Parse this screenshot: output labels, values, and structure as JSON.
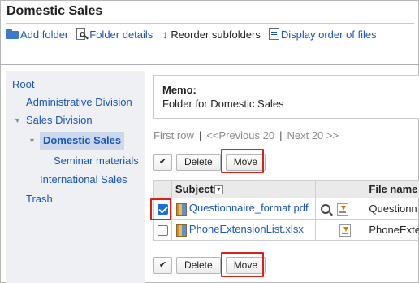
{
  "page": {
    "title": "Domestic Sales"
  },
  "toolbar": {
    "add_folder": "Add folder",
    "folder_details": "Folder details",
    "reorder_subfolders": "Reorder subfolders",
    "display_order": "Display order of files"
  },
  "sidebar": {
    "root": "Root",
    "admin": "Administrative Division",
    "sales": "Sales Division",
    "domestic": "Domestic Sales",
    "seminar": "Seminar materials",
    "international": "International Sales",
    "trash": "Trash"
  },
  "memo": {
    "label": "Memo:",
    "text": "Folder for Domestic Sales"
  },
  "pager": {
    "first": "First row",
    "prev": "<<Previous 20",
    "next": "Next 20 >>",
    "sep": "|"
  },
  "buttons": {
    "check": "✔",
    "delete": "Delete",
    "move": "Move"
  },
  "table": {
    "headers": {
      "subject": "Subject",
      "file_name": "File name"
    },
    "rows": [
      {
        "subject": "Questionnaire_format.pdf",
        "file_name": "Questionn",
        "checked": true
      },
      {
        "subject": "PhoneExtensionList.xlsx",
        "file_name": "PhoneExte",
        "checked": false
      }
    ]
  },
  "colors": {
    "link": "#1a56b8",
    "highlight": "#d9201a",
    "checkbox_on": "#1a6fe0",
    "sidebar_bg": "#eef0f4"
  }
}
